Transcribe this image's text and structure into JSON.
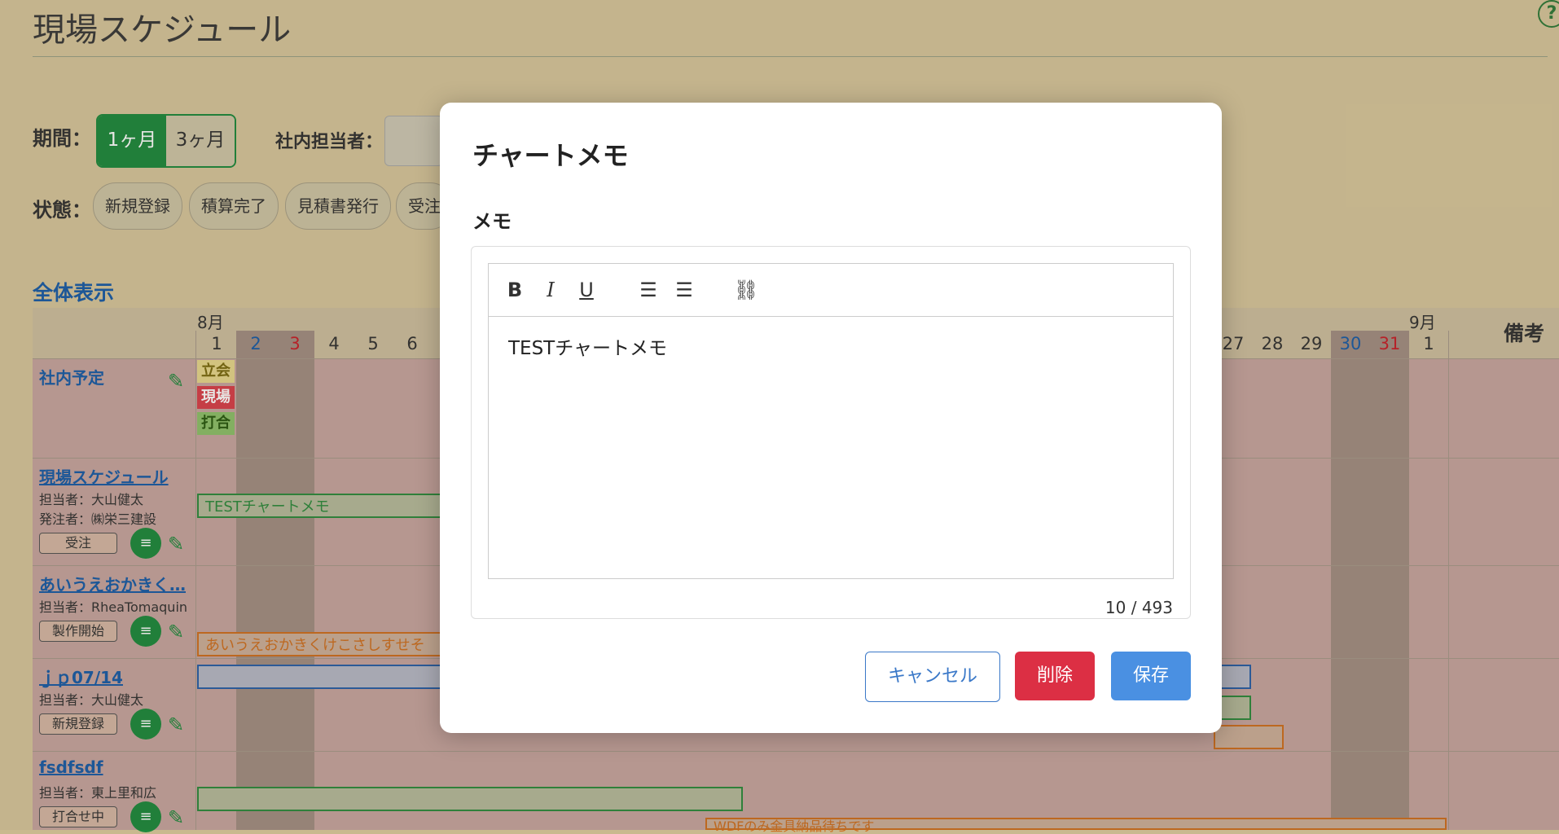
{
  "page": {
    "title": "現場スケジュール",
    "help_icon": "?",
    "period_label": "期間：",
    "period_options": [
      "1ヶ月",
      "3ヶ月"
    ],
    "staff_label": "社内担当者：",
    "status_label": "状態：",
    "status_chips": [
      "新規登録",
      "積算完了",
      "見積書発行",
      "受注"
    ],
    "section_title": "全体表示",
    "month_aug": "8月",
    "month_sep": "9月",
    "days_left": [
      "1",
      "2",
      "3",
      "4",
      "5",
      "6"
    ],
    "days_right": [
      "27",
      "28",
      "29",
      "30",
      "31",
      "1"
    ],
    "remarks_header": "備考",
    "internal_schedule": {
      "title": "社内予定",
      "tags": [
        "立会",
        "現場",
        "打合"
      ]
    },
    "rows": [
      {
        "title": "現場スケジュール",
        "sub1": "担当者：大山健太",
        "sub2": "発注者：㈱栄三建設",
        "status": "受注",
        "bar": "TESTチャートメモ"
      },
      {
        "title": "あいうえおかきく…",
        "sub1": "担当者：RheaTomaquin",
        "status": "製作開始",
        "bar": "あいうえおかきくけこさしすせそ"
      },
      {
        "title": "ｊｐ07/14",
        "sub1": "担当者：大山健太",
        "status": "新規登録"
      },
      {
        "title": "fsdfsdf",
        "sub1": "担当者：東上里和広",
        "status": "打合せ中",
        "bar2": "WDFのみ金具納品待ちです"
      }
    ]
  },
  "modal": {
    "title": "チャートメモ",
    "field_label": "メモ",
    "toolbar": {
      "bold": "B",
      "italic": "I",
      "underline": "U",
      "ordered_list": "☰",
      "bullet_list": "☰",
      "link": "⛓"
    },
    "content": "TESTチャートメモ",
    "counter": "10 / 493",
    "cancel": "キャンセル",
    "delete": "削除",
    "save": "保存"
  }
}
